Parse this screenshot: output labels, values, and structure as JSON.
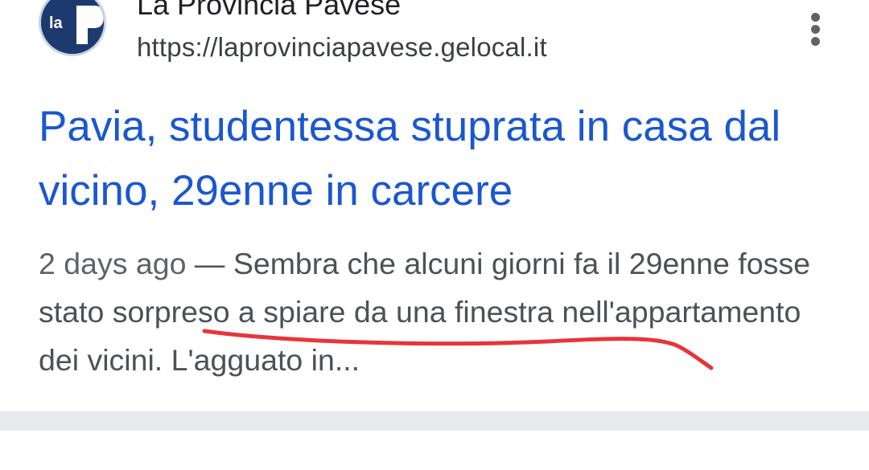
{
  "result": {
    "site_name": "La Provincia Pavese",
    "url": "https://laprovinciapavese.gelocal.it",
    "favicon_text": "la",
    "headline": "Pavia, studentessa stuprata in casa dal vicino, 29enne in carcere",
    "snippet_date": "2 days ago",
    "snippet_separator": " — ",
    "snippet_text": "Sembra che alcuni giorni fa il 29enne fosse stato sorpreso a spiare da una finestra nell'appartamento dei vicini. L'agguato in..."
  },
  "colors": {
    "headline": "#1a57d0",
    "favicon_bg": "#1c3a6e",
    "annotation_stroke": "#e8343c",
    "divider": "#e8eaed"
  },
  "icons": {
    "more": "more-vert-icon"
  }
}
